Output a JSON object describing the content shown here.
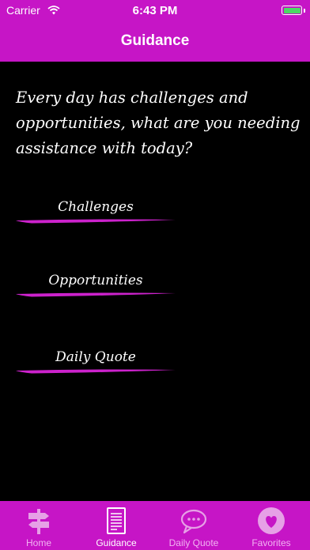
{
  "status_bar": {
    "carrier": "Carrier",
    "time": "6:43 PM"
  },
  "nav": {
    "title": "Guidance"
  },
  "prompt": "Every day has challenges and opportunities, what are you needing assistance with today?",
  "options": [
    {
      "label": "Challenges"
    },
    {
      "label": "Opportunities"
    },
    {
      "label": "Daily Quote"
    }
  ],
  "tabs": [
    {
      "label": "Home",
      "icon": "signpost-icon",
      "active": false
    },
    {
      "label": "Guidance",
      "icon": "document-icon",
      "active": true
    },
    {
      "label": "Daily Quote",
      "icon": "speech-bubble-icon",
      "active": false
    },
    {
      "label": "Favorites",
      "icon": "heart-icon",
      "active": false
    }
  ],
  "colors": {
    "brand": "#c615c6",
    "background": "#000000",
    "underline": "#cc22cc",
    "battery": "#4cd964"
  }
}
